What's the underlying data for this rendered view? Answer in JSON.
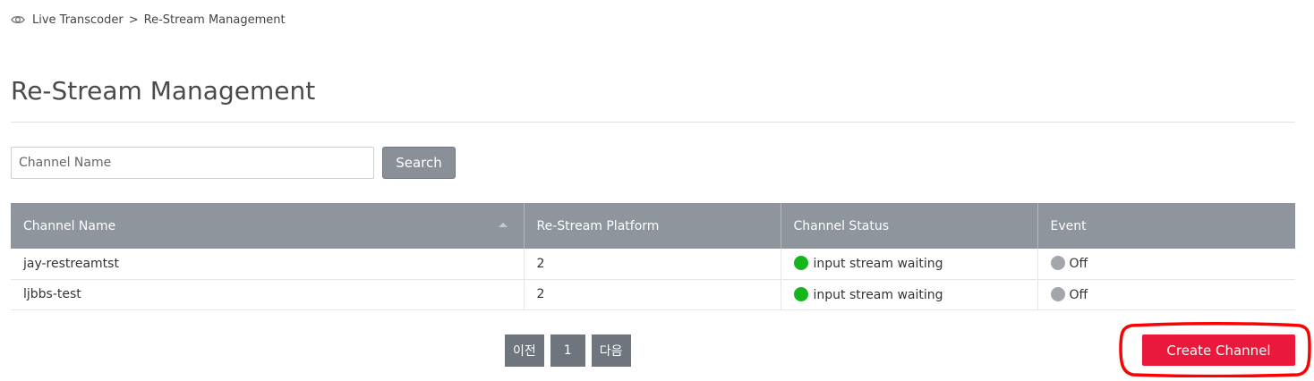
{
  "breadcrumb": {
    "icon": "eye-icon",
    "root": "Live Transcoder",
    "separator": ">",
    "current": "Re-Stream Management"
  },
  "page_title": "Re-Stream Management",
  "search": {
    "placeholder": "Channel Name",
    "value": "",
    "button_label": "Search"
  },
  "table": {
    "headers": {
      "channel_name": "Channel Name",
      "platform": "Re-Stream Platform",
      "status": "Channel Status",
      "event": "Event"
    },
    "rows": [
      {
        "channel_name": "jay-restreamtst",
        "platform": "2",
        "status": "input stream waiting",
        "status_color": "#16b51a",
        "event": "Off",
        "event_color": "#a3a7ab"
      },
      {
        "channel_name": "ljbbs-test",
        "platform": "2",
        "status": "input stream waiting",
        "status_color": "#16b51a",
        "event": "Off",
        "event_color": "#a3a7ab"
      }
    ]
  },
  "pagination": {
    "prev_label": "이전",
    "page": "1",
    "next_label": "다음"
  },
  "create_button_label": "Create Channel",
  "colors": {
    "accent": "#e8193a",
    "header_bg": "#8f959d",
    "status_active": "#16b51a",
    "status_off": "#a3a7ab",
    "annotation": "#ff0000"
  }
}
